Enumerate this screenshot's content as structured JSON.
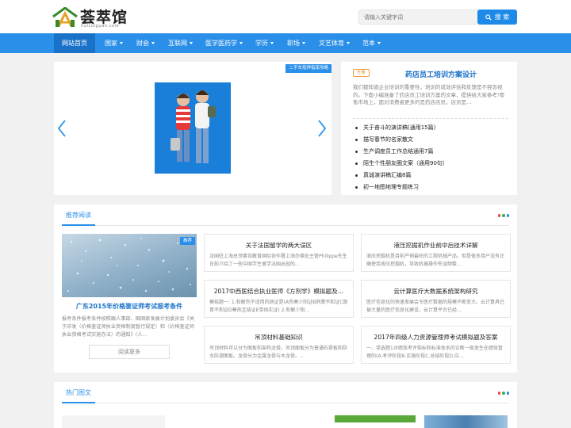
{
  "header": {
    "logo_text": "荟萃馆",
    "logo_sub": "huicuiguan.com",
    "search_placeholder": "请输入关键字词",
    "search_button": "搜 索"
  },
  "nav": {
    "items": [
      {
        "label": "网站首页",
        "dropdown": false,
        "active": true
      },
      {
        "label": "国家",
        "dropdown": true
      },
      {
        "label": "财会",
        "dropdown": true
      },
      {
        "label": "互联网",
        "dropdown": true
      },
      {
        "label": "医学医药学",
        "dropdown": true
      },
      {
        "label": "学历",
        "dropdown": true
      },
      {
        "label": "职场",
        "dropdown": true
      },
      {
        "label": "文艺体育",
        "dropdown": true
      },
      {
        "label": "范本",
        "dropdown": true
      }
    ]
  },
  "slider": {
    "tag": "二手车抵押指南攻略"
  },
  "topcard": {
    "badge": "头条",
    "title": "药店员工培训方案设计",
    "desc": "我们都知道企业培训的重要性，培训的成效评估和反馈是不容忽视的。下面小编准备了药店员工培训方案的文章，提供给大家参考!零售市场上，面对消费者更多的是药店店员，店员是…",
    "list": [
      "关于奋斗的演讲稿(通用15篇)",
      "描写春节的名家散文",
      "生产调度员工作总结通用7篇",
      "陌生个性朋友圈文案（通用90句）",
      "真诚演讲稿汇编8篇",
      "初一地图地理专题练习"
    ]
  },
  "recommend": {
    "title": "推荐阅读",
    "featured": {
      "tag": "推荐",
      "title": "广东2015年价格鉴证师考试报考条件",
      "desc": "报考条件报考条件按照跟人事部、国国家发展计划委员会《关于印发〈价格鉴证师执业资格制度暂行规定〉和〈价格鉴证师执业资格考试实施办法〉的通知》(人…",
      "button": "阅读更多"
    },
    "articles": [
      {
        "title": "关于法国留学的两大误区",
        "desc": "法国驻上海总领事馆教育国际协作署上海办事处主管Philippe先生日前介绍了一些中国学生留学法国出现的…"
      },
      {
        "title": "液压挖掘机作业前中后技术详解",
        "desc": "液压挖掘机是目前产销最旺的工程机械产品，但是很多用户没有正确使用液压挖掘机，导致机器操作失误频繁…"
      },
      {
        "title": "2017中西医结合执业医师《方剂学》模拟题及…",
        "desc": "模拟题一: 1.和解剂不适用的病证是(A伤寒少阳证B肝脾不和证C肠胃不和证D寒热互结证E单纯实证) 2.和解少阳…"
      },
      {
        "title": "云计算医疗大数据系统架构研究",
        "desc": "医疗信息化的快速发展会令医疗数据的规模不断变大。云计算具已被大量的医疗信息化建设，云计算平台已经…"
      },
      {
        "title": "吊顶材料基础知识",
        "desc": "吊顶材料可以分为面板和架构龙骨。吊顶面板分为普通石膏板和防水防潮面板。龙骨分为金属龙骨与木龙骨。…"
      },
      {
        "title": "2017年四级人力资源管理师考试模拟题及答案",
        "desc": "一、单选题1对绩效考评指标和标准体系的诊断一般发生在绩效管理的(A.考评阶段B.实施阶段C.总结阶段D.应…"
      }
    ]
  },
  "hot": {
    "title": "热门图文"
  },
  "colors": {
    "brand_blue": "#2a8fe8",
    "nav_active": "#1a72c8",
    "badge_orange": "#e88a1a",
    "dot_red": "#e5484d",
    "dot_green": "#3bb24a",
    "dot_blue": "#2a8fe8"
  }
}
